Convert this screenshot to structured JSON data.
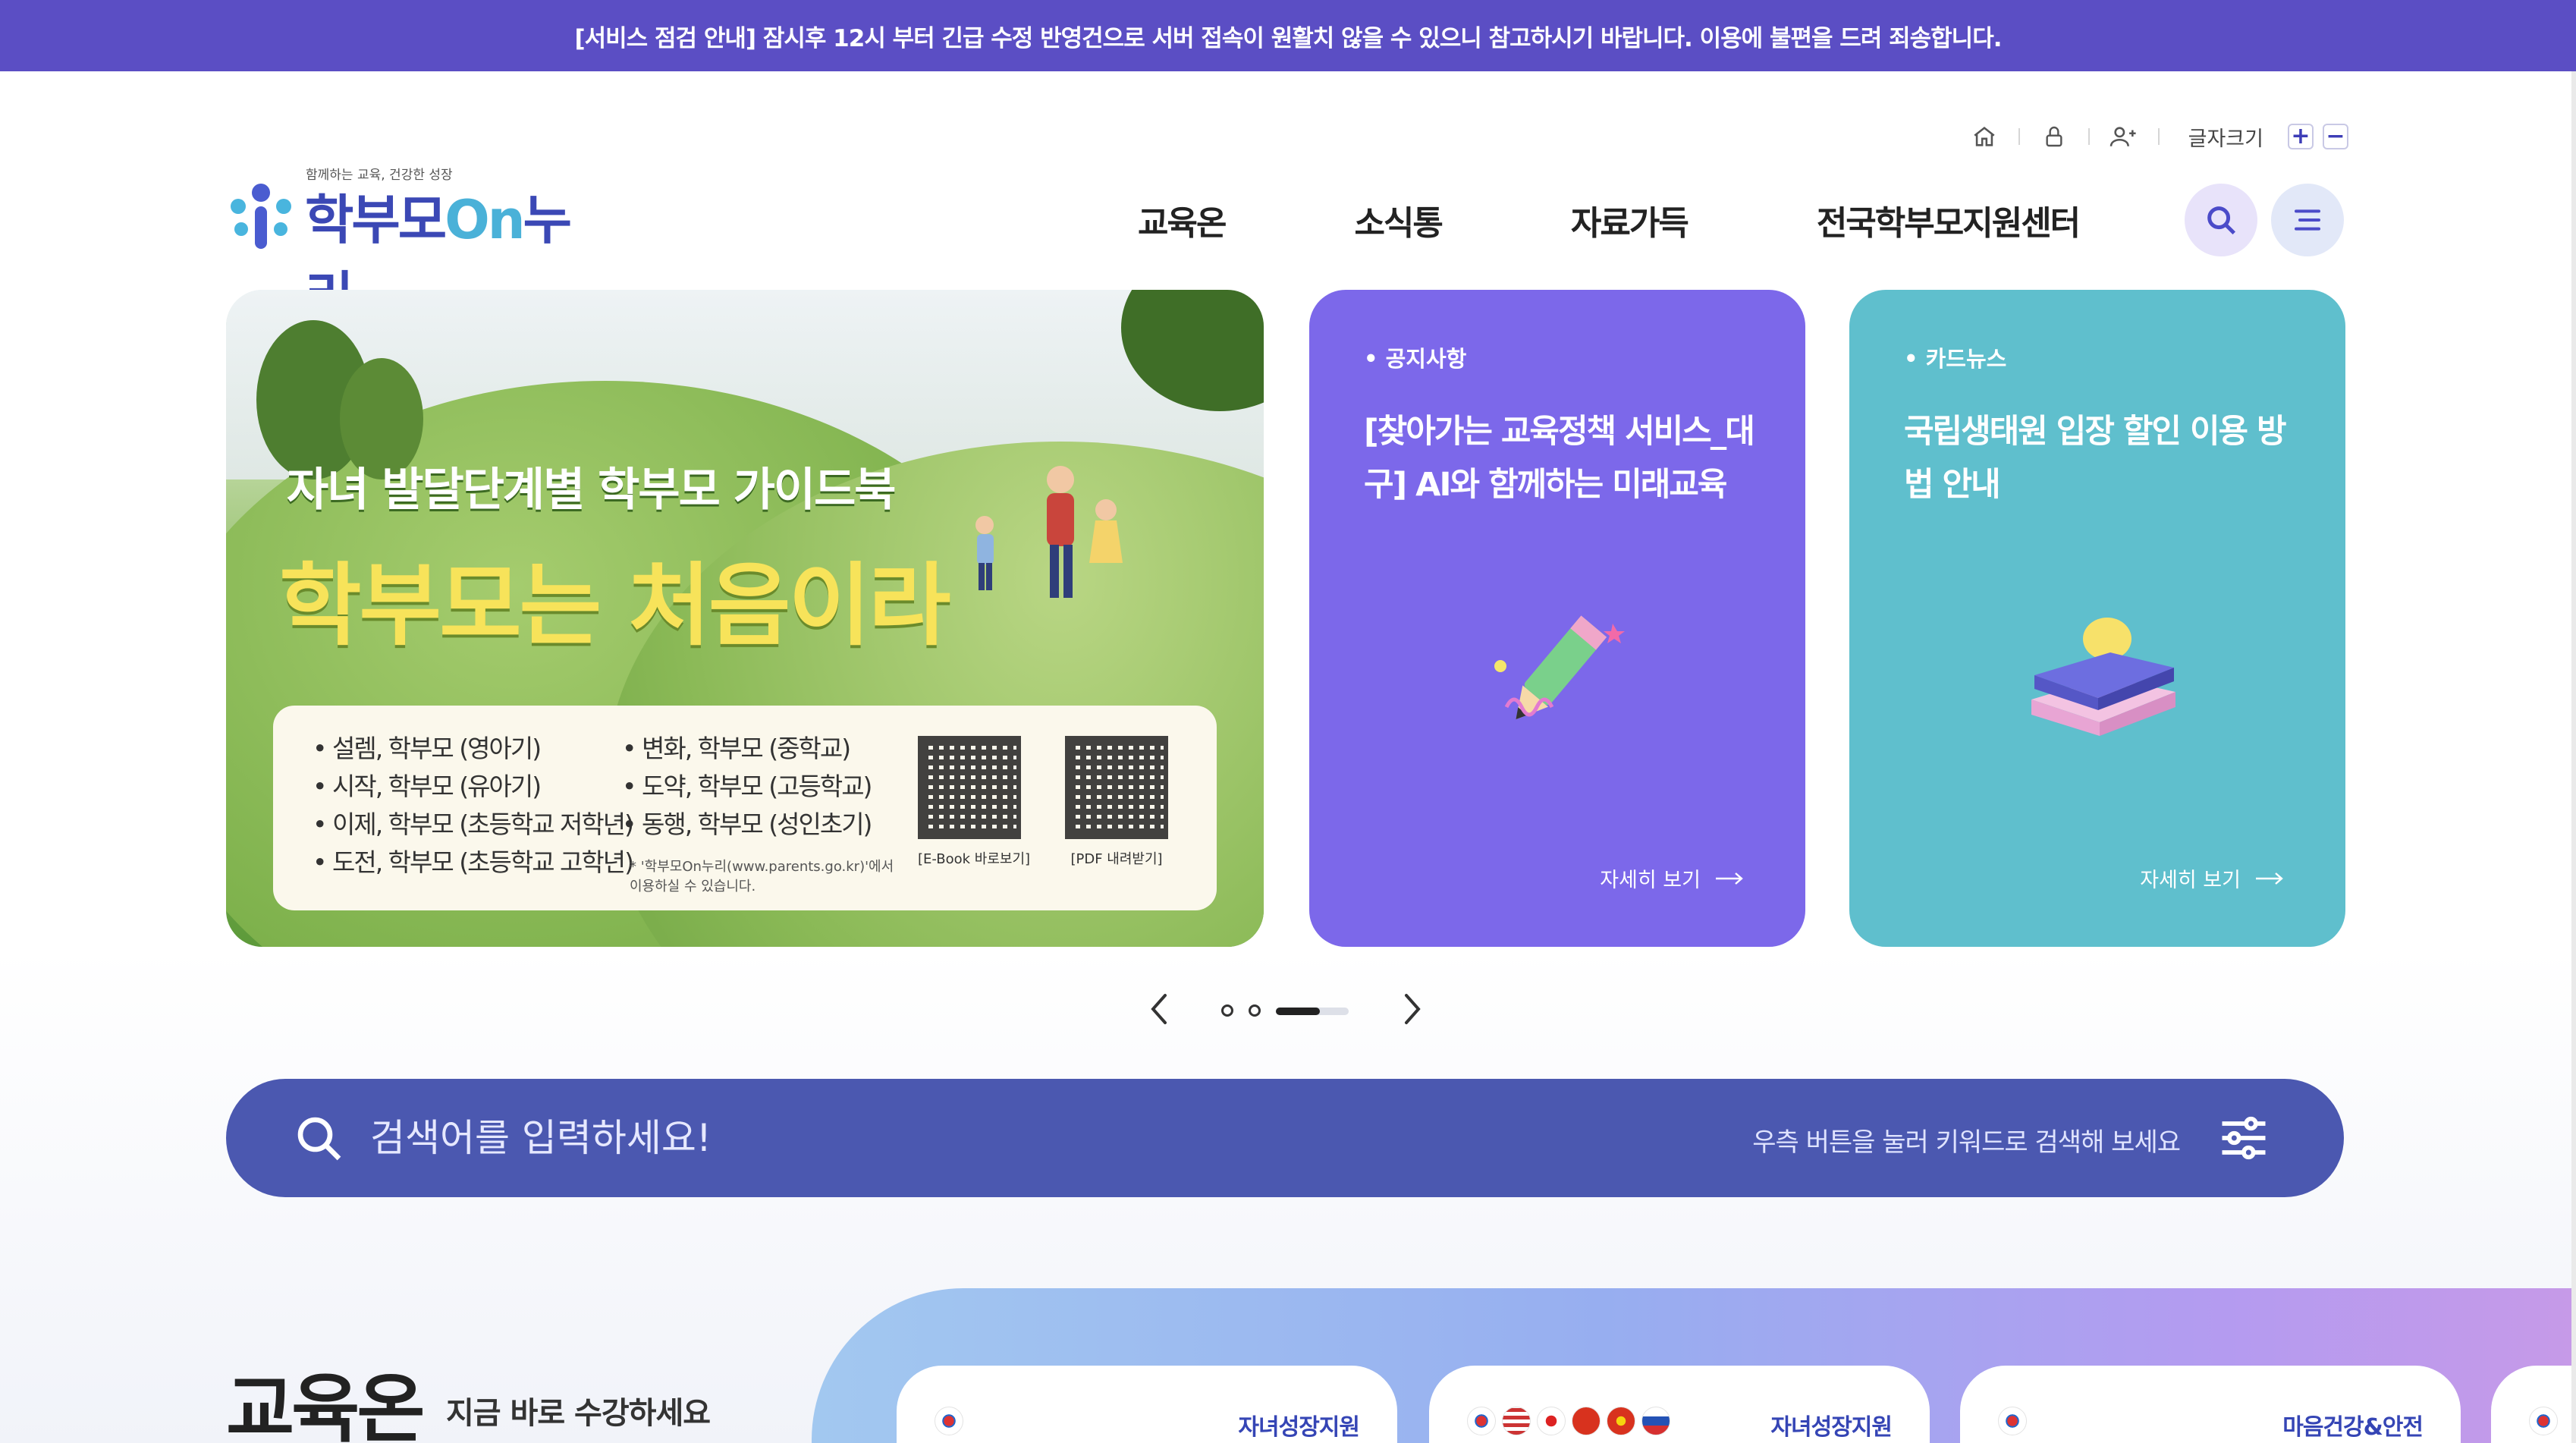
{
  "notice_bar": {
    "text": "[서비스 점검 안내] 잠시후 12시 부터 긴급 수정 반영건으로 서버 접속이 원활치 않을 수 있으니 참고하시기 바랍니다. 이용에 불편을 드려 죄송합니다."
  },
  "utility": {
    "icons": [
      "home-icon",
      "lock-icon",
      "add-user-icon"
    ],
    "font_size_label": "글자크기",
    "font_plus": "+",
    "font_minus": "−"
  },
  "logo": {
    "tagline": "함께하는 교육, 건강한 성장",
    "name_part1": "학부모",
    "name_part2": "On",
    "name_part3": "누리"
  },
  "nav": {
    "items": [
      "교육온",
      "소식통",
      "자료가득",
      "전국학부모지원센터"
    ],
    "search_icon": "search-icon",
    "menu_icon": "hamburger-menu-icon"
  },
  "hero": {
    "title_small": "자녀 발달단계별 학부모 가이드북",
    "title_big": "학부모는 처음이라",
    "list_left": [
      "설렘, 학부모 (영아기)",
      "시작, 학부모 (유아기)",
      "이제, 학부모 (초등학교 저학년)",
      "도전, 학부모 (초등학교 고학년)"
    ],
    "list_right": [
      "변화, 학부모 (중학교)",
      "도약, 학부모 (고등학교)",
      "동행, 학부모 (성인초기)"
    ],
    "note": "* '학부모On누리(www.parents.go.kr)'에서 이용하실 수 있습니다.",
    "qr_caption_1": "[E-Book 바로보기]",
    "qr_caption_2": "[PDF 내려받기]"
  },
  "cards": [
    {
      "category": "• 공지사항",
      "title": "[찾아가는 교육정책 서비스_대구] AI와 함께하는 미래교육",
      "more": "자세히 보기",
      "color": "#7c68ea"
    },
    {
      "category": "• 카드뉴스",
      "title": "국립생태원 입장 할인 이용 방법 안내",
      "more": "자세히 보기",
      "color": "#5fbfcd"
    }
  ],
  "slider": {
    "prev_icon": "chevron-left-icon",
    "next_icon": "chevron-right-icon",
    "total_slides": 3,
    "active_slide": 3,
    "progress": 0.6
  },
  "search": {
    "placeholder": "검색어를 입력하세요!",
    "hint": "우측 버튼을 눌러 키워드로 검색해 보세요",
    "filter_icon": "filter-sliders-icon"
  },
  "education": {
    "title": "교육온",
    "subtitle": "지금 바로 수강하세요",
    "cards": [
      {
        "tag": "자녀성장지원",
        "flags": [
          "kr"
        ]
      },
      {
        "tag": "자녀성장지원",
        "flags": [
          "kr",
          "us",
          "jp",
          "cn",
          "vn",
          "ru"
        ]
      },
      {
        "tag": "마음건강&안전",
        "flags": [
          "kr"
        ]
      },
      {
        "tag": "",
        "flags": [
          "kr"
        ]
      }
    ]
  },
  "colors": {
    "notice_bar": "#5b4ec4",
    "brand_blue": "#3b48b5",
    "search_bar": "#4b58b0"
  }
}
